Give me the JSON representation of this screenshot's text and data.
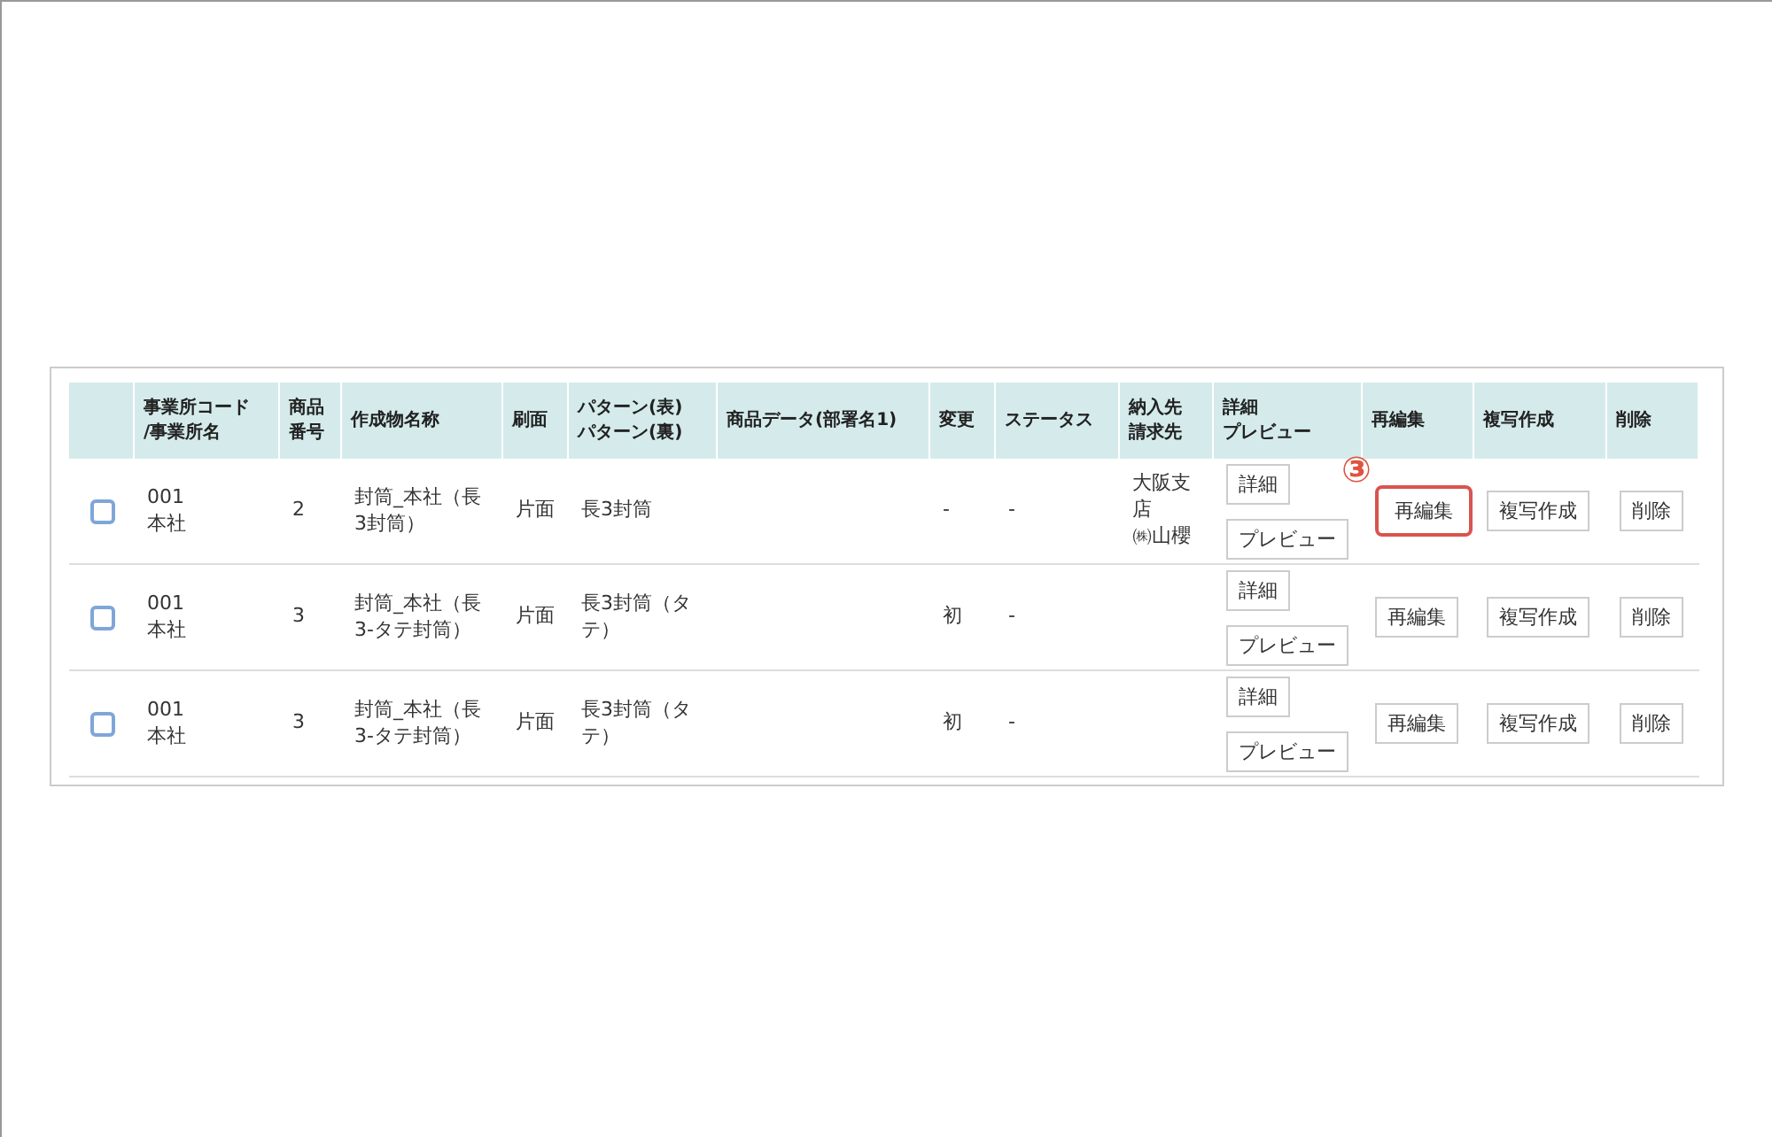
{
  "table": {
    "columns": [
      {
        "lines": [
          "事業所コード",
          "/事業所名"
        ]
      },
      {
        "lines": [
          "商品",
          "番号"
        ]
      },
      {
        "lines": [
          "作成物名称"
        ]
      },
      {
        "lines": [
          "刷面"
        ]
      },
      {
        "lines": [
          "パターン(表)",
          "パターン(裏)"
        ]
      },
      {
        "lines": [
          "商品データ(部署名1)"
        ]
      },
      {
        "lines": [
          "変更"
        ]
      },
      {
        "lines": [
          "ステータス"
        ]
      },
      {
        "lines": [
          "納入先",
          "請求先"
        ]
      },
      {
        "lines": [
          "詳細",
          "プレビュー"
        ]
      },
      {
        "lines": [
          "再編集"
        ]
      },
      {
        "lines": [
          "複写作成"
        ]
      },
      {
        "lines": [
          "削除"
        ]
      }
    ],
    "rows": [
      {
        "checked": false,
        "code": "001",
        "office": "本社",
        "number": "2",
        "name": "封筒_本社（長3封筒）",
        "side": "片面",
        "pattern": "長3封筒",
        "product_data": "",
        "change": "-",
        "status": "-",
        "delivery": "大阪支店",
        "billing": "㈱山櫻",
        "detail": "詳細",
        "preview": "プレビュー",
        "reedit": "再編集",
        "reedit_highlighted": true,
        "copy": "複写作成",
        "delete": "削除"
      },
      {
        "checked": false,
        "code": "001",
        "office": "本社",
        "number": "3",
        "name": "封筒_本社（長3-タテ封筒）",
        "side": "片面",
        "pattern": "長3封筒（タテ）",
        "product_data": "",
        "change": "初",
        "status": "-",
        "delivery": "",
        "billing": "",
        "detail": "詳細",
        "preview": "プレビュー",
        "reedit": "再編集",
        "reedit_highlighted": false,
        "copy": "複写作成",
        "delete": "削除"
      },
      {
        "checked": false,
        "code": "001",
        "office": "本社",
        "number": "3",
        "name": "封筒_本社（長3-タテ封筒）",
        "side": "片面",
        "pattern": "長3封筒（タテ）",
        "product_data": "",
        "change": "初",
        "status": "-",
        "delivery": "",
        "billing": "",
        "detail": "詳細",
        "preview": "プレビュー",
        "reedit": "再編集",
        "reedit_highlighted": false,
        "copy": "複写作成",
        "delete": "削除"
      }
    ]
  },
  "callout": {
    "label": "③"
  }
}
